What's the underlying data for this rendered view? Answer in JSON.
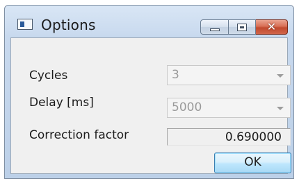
{
  "window": {
    "title": "Options"
  },
  "fields": {
    "cycles": {
      "label": "Cycles",
      "value": "3"
    },
    "delay": {
      "label": "Delay [ms]",
      "value": "5000"
    },
    "correction": {
      "label": "Correction factor",
      "value": "0.690000"
    }
  },
  "buttons": {
    "ok_label": "OK"
  },
  "icons": {
    "app": "window-app-icon",
    "minimize": "minimize-icon",
    "maximize": "maximize-icon",
    "close": "close-icon",
    "dropdown": "chevron-down-icon"
  },
  "colors": {
    "title_bar": "#c8d9ee",
    "close_button": "#d0644a",
    "ok_button": "#bee6fd"
  }
}
